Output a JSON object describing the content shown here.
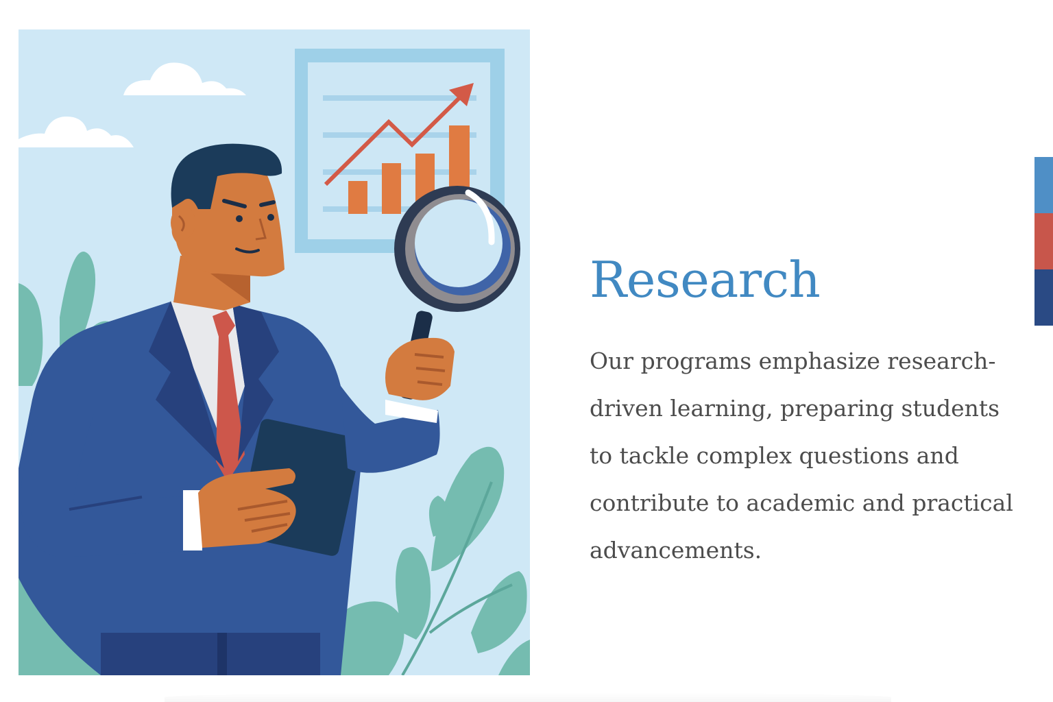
{
  "section": {
    "title": "Research",
    "description": "Our programs emphasize research-driven learning, preparing students to tackle complex questions and contribute to academic and practical advancements."
  },
  "illustration": {
    "subject": "researcher-with-magnifying-glass",
    "icons": [
      "cloud-icon",
      "growth-chart-icon",
      "magnifying-glass-icon",
      "tablet-icon",
      "leaf-icon"
    ]
  },
  "colors": {
    "title": "#4189c2",
    "text": "#4c4c4c",
    "accent_light_blue": "#4f8fc6",
    "accent_red": "#c8564b",
    "accent_navy": "#2a4a84",
    "illustration_bg": "#cfe8f6"
  }
}
